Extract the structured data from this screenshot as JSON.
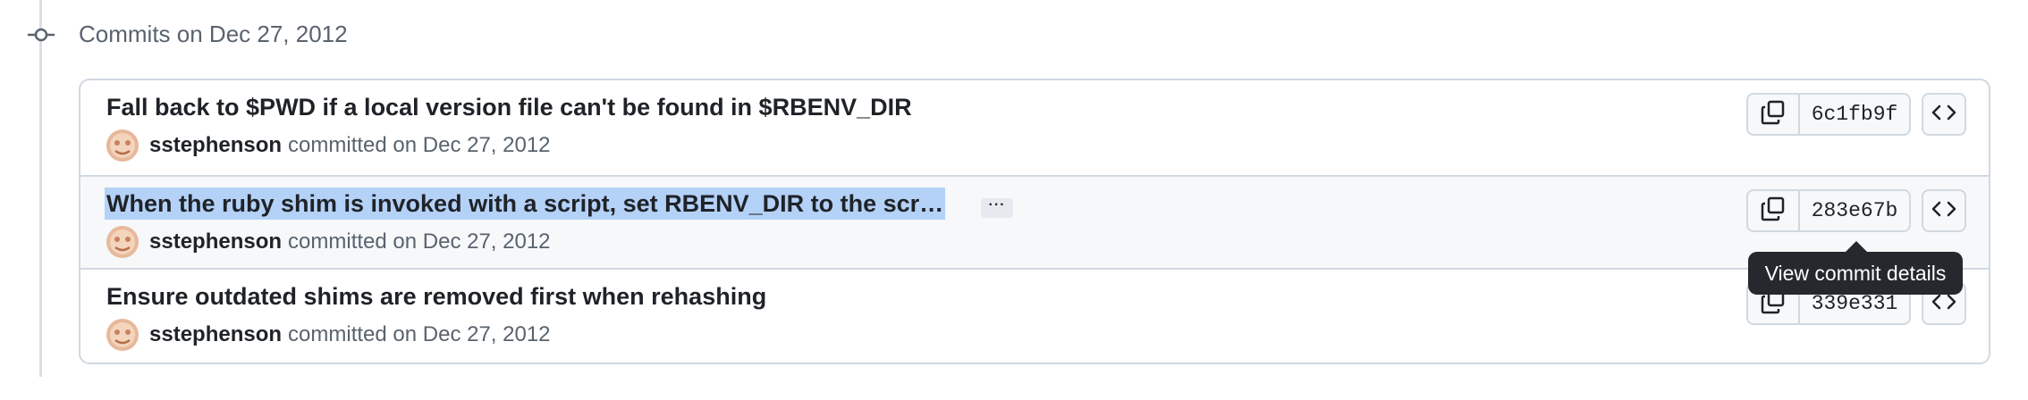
{
  "group": {
    "heading": "Commits on Dec 27, 2012"
  },
  "commits": [
    {
      "title": "Fall back to $PWD if a local version file can't be found in $RBENV_DIR",
      "author": "sstephenson",
      "committed_text": "committed on Dec 27, 2012",
      "sha": "6c1fb9f"
    },
    {
      "title": "When the ruby shim is invoked with a script, set RBENV_DIR to the scr…",
      "author": "sstephenson",
      "committed_text": "committed on Dec 27, 2012",
      "sha": "283e67b",
      "expand_label": "···"
    },
    {
      "title": "Ensure outdated shims are removed first when rehashing",
      "author": "sstephenson",
      "committed_text": "committed on Dec 27, 2012",
      "sha": "339e331"
    }
  ],
  "tooltip": {
    "text": "View commit details"
  },
  "icons": {
    "timeline_node": "git-commit-icon",
    "copy": "copy-icon",
    "browse": "code-icon",
    "avatar": "avatar"
  },
  "colors": {
    "selection": "#b4d1f7",
    "tooltip_bg": "#25292e",
    "border": "#d1d9e0",
    "muted_text": "#59636e"
  }
}
